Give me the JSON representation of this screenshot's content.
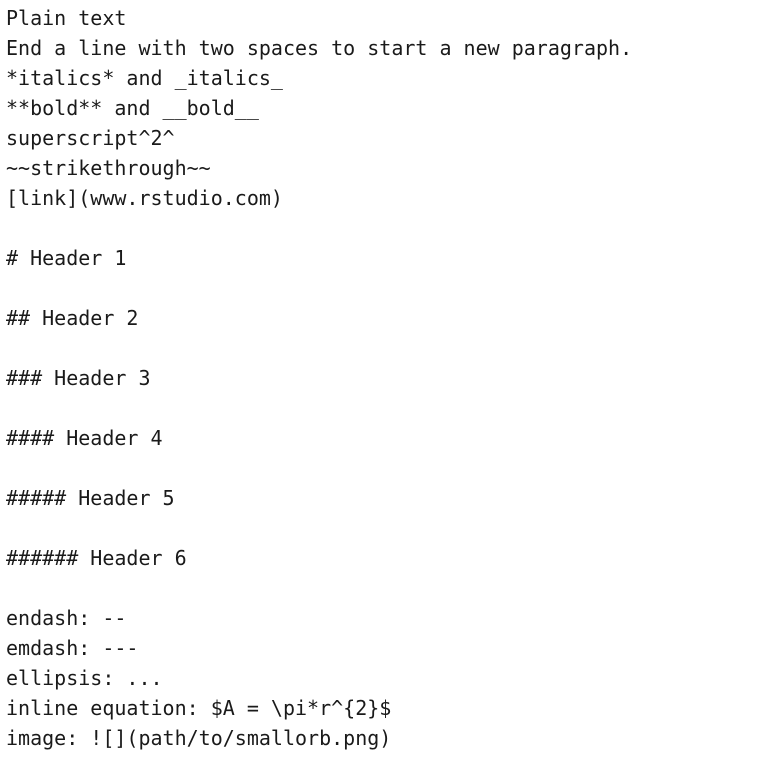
{
  "lines": [
    "Plain text",
    "End a line with two spaces to start a new paragraph.",
    "*italics* and _italics_",
    "**bold** and __bold__",
    "superscript^2^",
    "~~strikethrough~~",
    "[link](www.rstudio.com)",
    "",
    "# Header 1",
    "",
    "## Header 2",
    "",
    "### Header 3",
    "",
    "#### Header 4",
    "",
    "##### Header 5",
    "",
    "###### Header 6",
    "",
    "endash: --",
    "emdash: ---",
    "ellipsis: ...",
    "inline equation: $A = \\pi*r^{2}$",
    "image: ![](path/to/smallorb.png)"
  ]
}
